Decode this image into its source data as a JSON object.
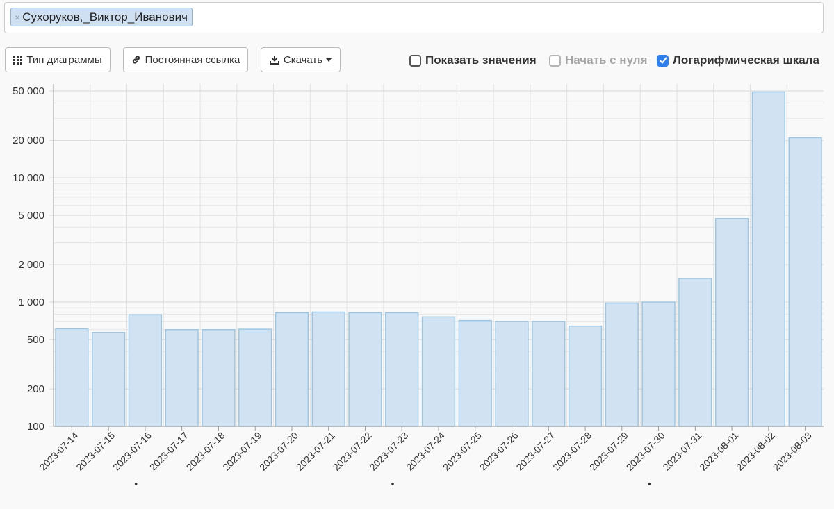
{
  "tag": {
    "remove_label": "×",
    "label": "Сухоруков,_Виктор_Иванович"
  },
  "toolbar": {
    "chart_type_label": "Тип диаграммы",
    "permalink_label": "Постоянная ссылка",
    "download_label": "Скачать",
    "show_values_label": "Показать значения",
    "show_values_checked": false,
    "start_zero_label": "Начать с нуля",
    "start_zero_checked": false,
    "log_scale_label": "Логарифмическая шкала",
    "log_scale_checked": true
  },
  "colors": {
    "bar_fill": "#d1e3f3",
    "bar_stroke": "#9dc6e2",
    "checkbox_accent": "#2f80ed"
  },
  "chart_data": {
    "type": "bar",
    "yscale": "log",
    "ylim": [
      100,
      50000
    ],
    "grid": true,
    "ytick_values": [
      100,
      200,
      500,
      1000,
      2000,
      5000,
      10000,
      20000,
      50000
    ],
    "ytick_labels": [
      "100",
      "200",
      "500",
      "1 000",
      "2 000",
      "5 000",
      "10 000",
      "20 000",
      "50 000"
    ],
    "categories": [
      "2023-07-14",
      "2023-07-15",
      "2023-07-16",
      "2023-07-17",
      "2023-07-18",
      "2023-07-19",
      "2023-07-20",
      "2023-07-21",
      "2023-07-22",
      "2023-07-23",
      "2023-07-24",
      "2023-07-25",
      "2023-07-26",
      "2023-07-27",
      "2023-07-28",
      "2023-07-29",
      "2023-07-30",
      "2023-07-31",
      "2023-08-01",
      "2023-08-02",
      "2023-08-03"
    ],
    "marked_categories": [
      "2023-07-17",
      "2023-07-24",
      "2023-07-31"
    ],
    "values": [
      610,
      570,
      790,
      600,
      600,
      605,
      820,
      830,
      820,
      820,
      760,
      710,
      700,
      700,
      640,
      980,
      1000,
      1550,
      4700,
      49000,
      21000
    ]
  }
}
